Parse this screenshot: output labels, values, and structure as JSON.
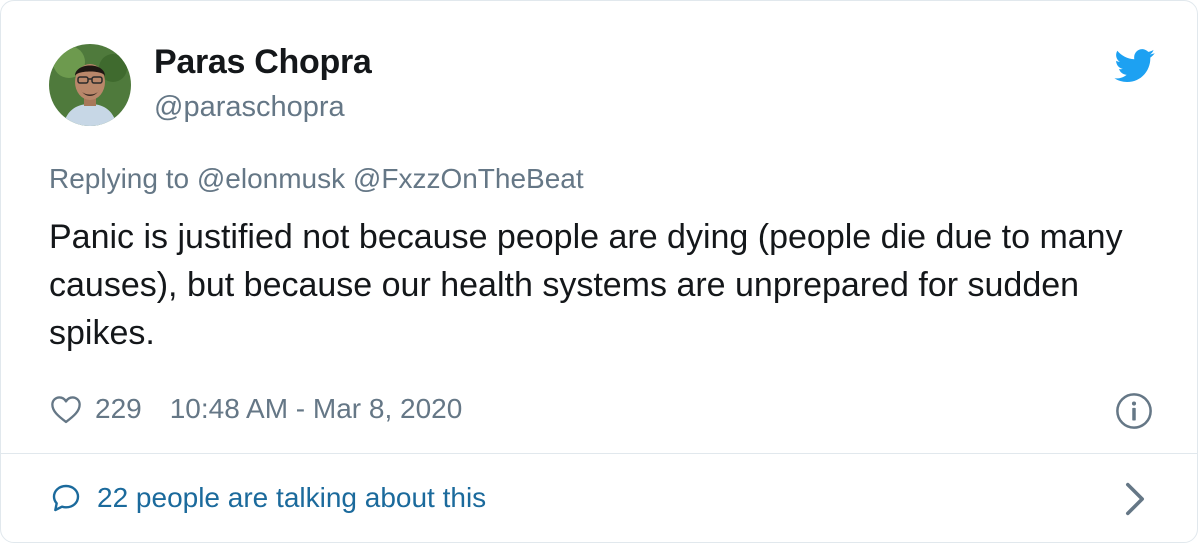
{
  "tweet": {
    "author": {
      "display_name": "Paras Chopra",
      "handle": "@paraschopra",
      "avatar": "profile-photo"
    },
    "replying_to": {
      "prefix": "Replying to",
      "users": [
        "@elonmusk",
        "@FxzzOnTheBeat"
      ]
    },
    "text": "Panic is justified not because people are dying (people die due to many causes), but because our health systems are unprepared for sudden spikes.",
    "likes": "229",
    "timestamp": "10:48 AM - Mar 8, 2020",
    "conversation_label": "22 people are talking about this"
  },
  "icons": {
    "logo": "twitter-bird-icon",
    "like": "heart-icon",
    "info": "info-icon",
    "conversation": "speech-bubble-icon",
    "expand": "chevron-right-icon"
  },
  "colors": {
    "brand": "#1da1f2",
    "text_primary": "#14171a",
    "text_secondary": "#657786",
    "link": "#1b6a9c",
    "border": "#e1e8ed"
  }
}
